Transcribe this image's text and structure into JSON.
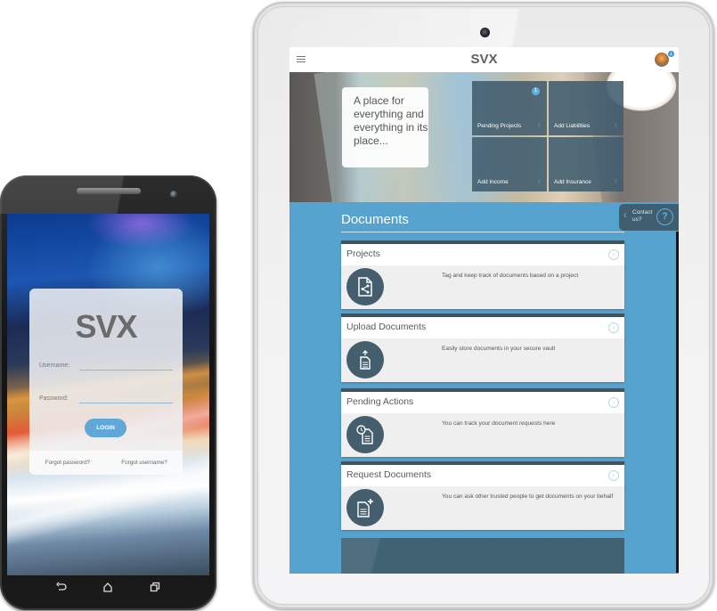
{
  "phone": {
    "login": {
      "logo": "SVX",
      "username_label": "Username:",
      "username_value": "",
      "password_label": "Password:",
      "password_value": "",
      "login_button": "LOGIN",
      "forgot_password": "Forgot password?",
      "forgot_username": "Forgot username?"
    },
    "nav": {
      "back_icon": "back-icon",
      "home_icon": "home-icon",
      "recents_icon": "recents-icon"
    }
  },
  "tablet": {
    "header": {
      "menu_icon": "hamburger-icon",
      "logo": "SVX",
      "notification_count": "1"
    },
    "hero": {
      "tagline": "A place for everything and everything in its place...",
      "tiles": [
        {
          "label": "Pending Projects",
          "badge": "1"
        },
        {
          "label": "Add Liabilities"
        },
        {
          "label": "Add Income"
        },
        {
          "label": "Add Insurance"
        }
      ]
    },
    "contact": {
      "label": "Contact us?",
      "icon": "?"
    },
    "documents": {
      "title": "Documents",
      "cards": [
        {
          "title": "Projects",
          "description": "Tag and keep track of documents based on a project",
          "icon": "document-share-icon"
        },
        {
          "title": "Upload Documents",
          "description": "Easily store documents in your secure vault",
          "icon": "document-upload-icon"
        },
        {
          "title": "Pending Actions",
          "description": "You can track your document requests here",
          "icon": "document-clock-icon"
        },
        {
          "title": "Request Documents",
          "description": "You can ask other trusted people to get documents on your behalf",
          "icon": "document-add-icon"
        }
      ]
    },
    "colors": {
      "accent_blue": "#56a3cf",
      "tile_slate": "#405c6e",
      "button_blue": "#5fa8d8",
      "text_gray": "#5a5a5a"
    }
  }
}
